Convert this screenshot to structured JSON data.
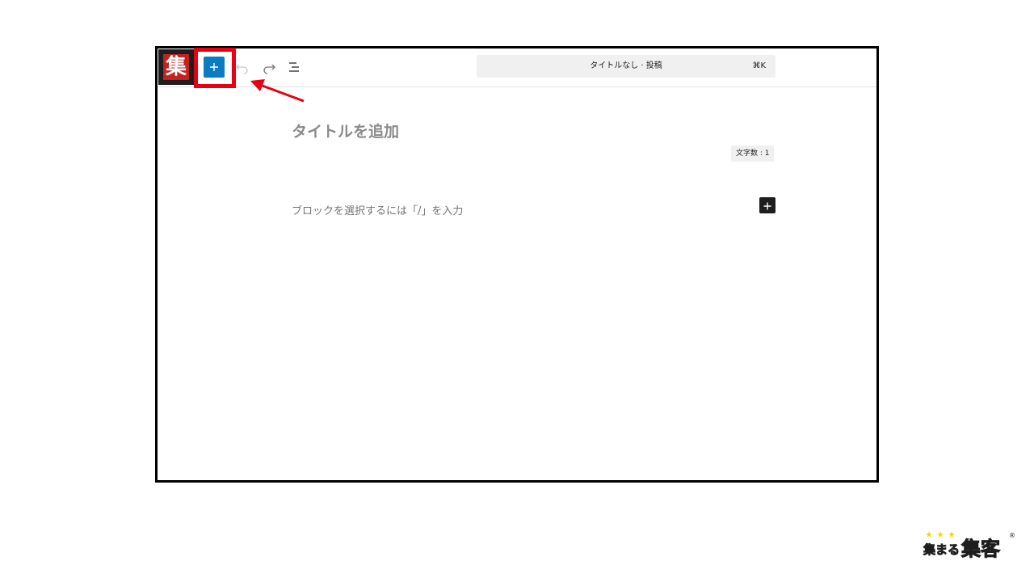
{
  "editor": {
    "site_logo_char": "集",
    "document_title": "タイトルなし · 投稿",
    "command_shortcut": "⌘K",
    "post_title_placeholder": "タイトルを追加",
    "char_count": "文字数 : 1",
    "block_placeholder": "ブロックを選択するには「/」を入力"
  },
  "toolbar": {
    "icons": [
      "plus-icon",
      "undo-icon",
      "redo-icon",
      "document-overview-icon"
    ]
  },
  "annotation": {
    "color": "#e60012"
  },
  "brand": {
    "logo_text": "集まる集客",
    "registered_mark": "®",
    "colors": {
      "pink": "#ef4f8a",
      "yellow": "#ffd400"
    }
  },
  "colors": {
    "accent": "#0a7cc0",
    "dark": "#1e1e1e"
  }
}
